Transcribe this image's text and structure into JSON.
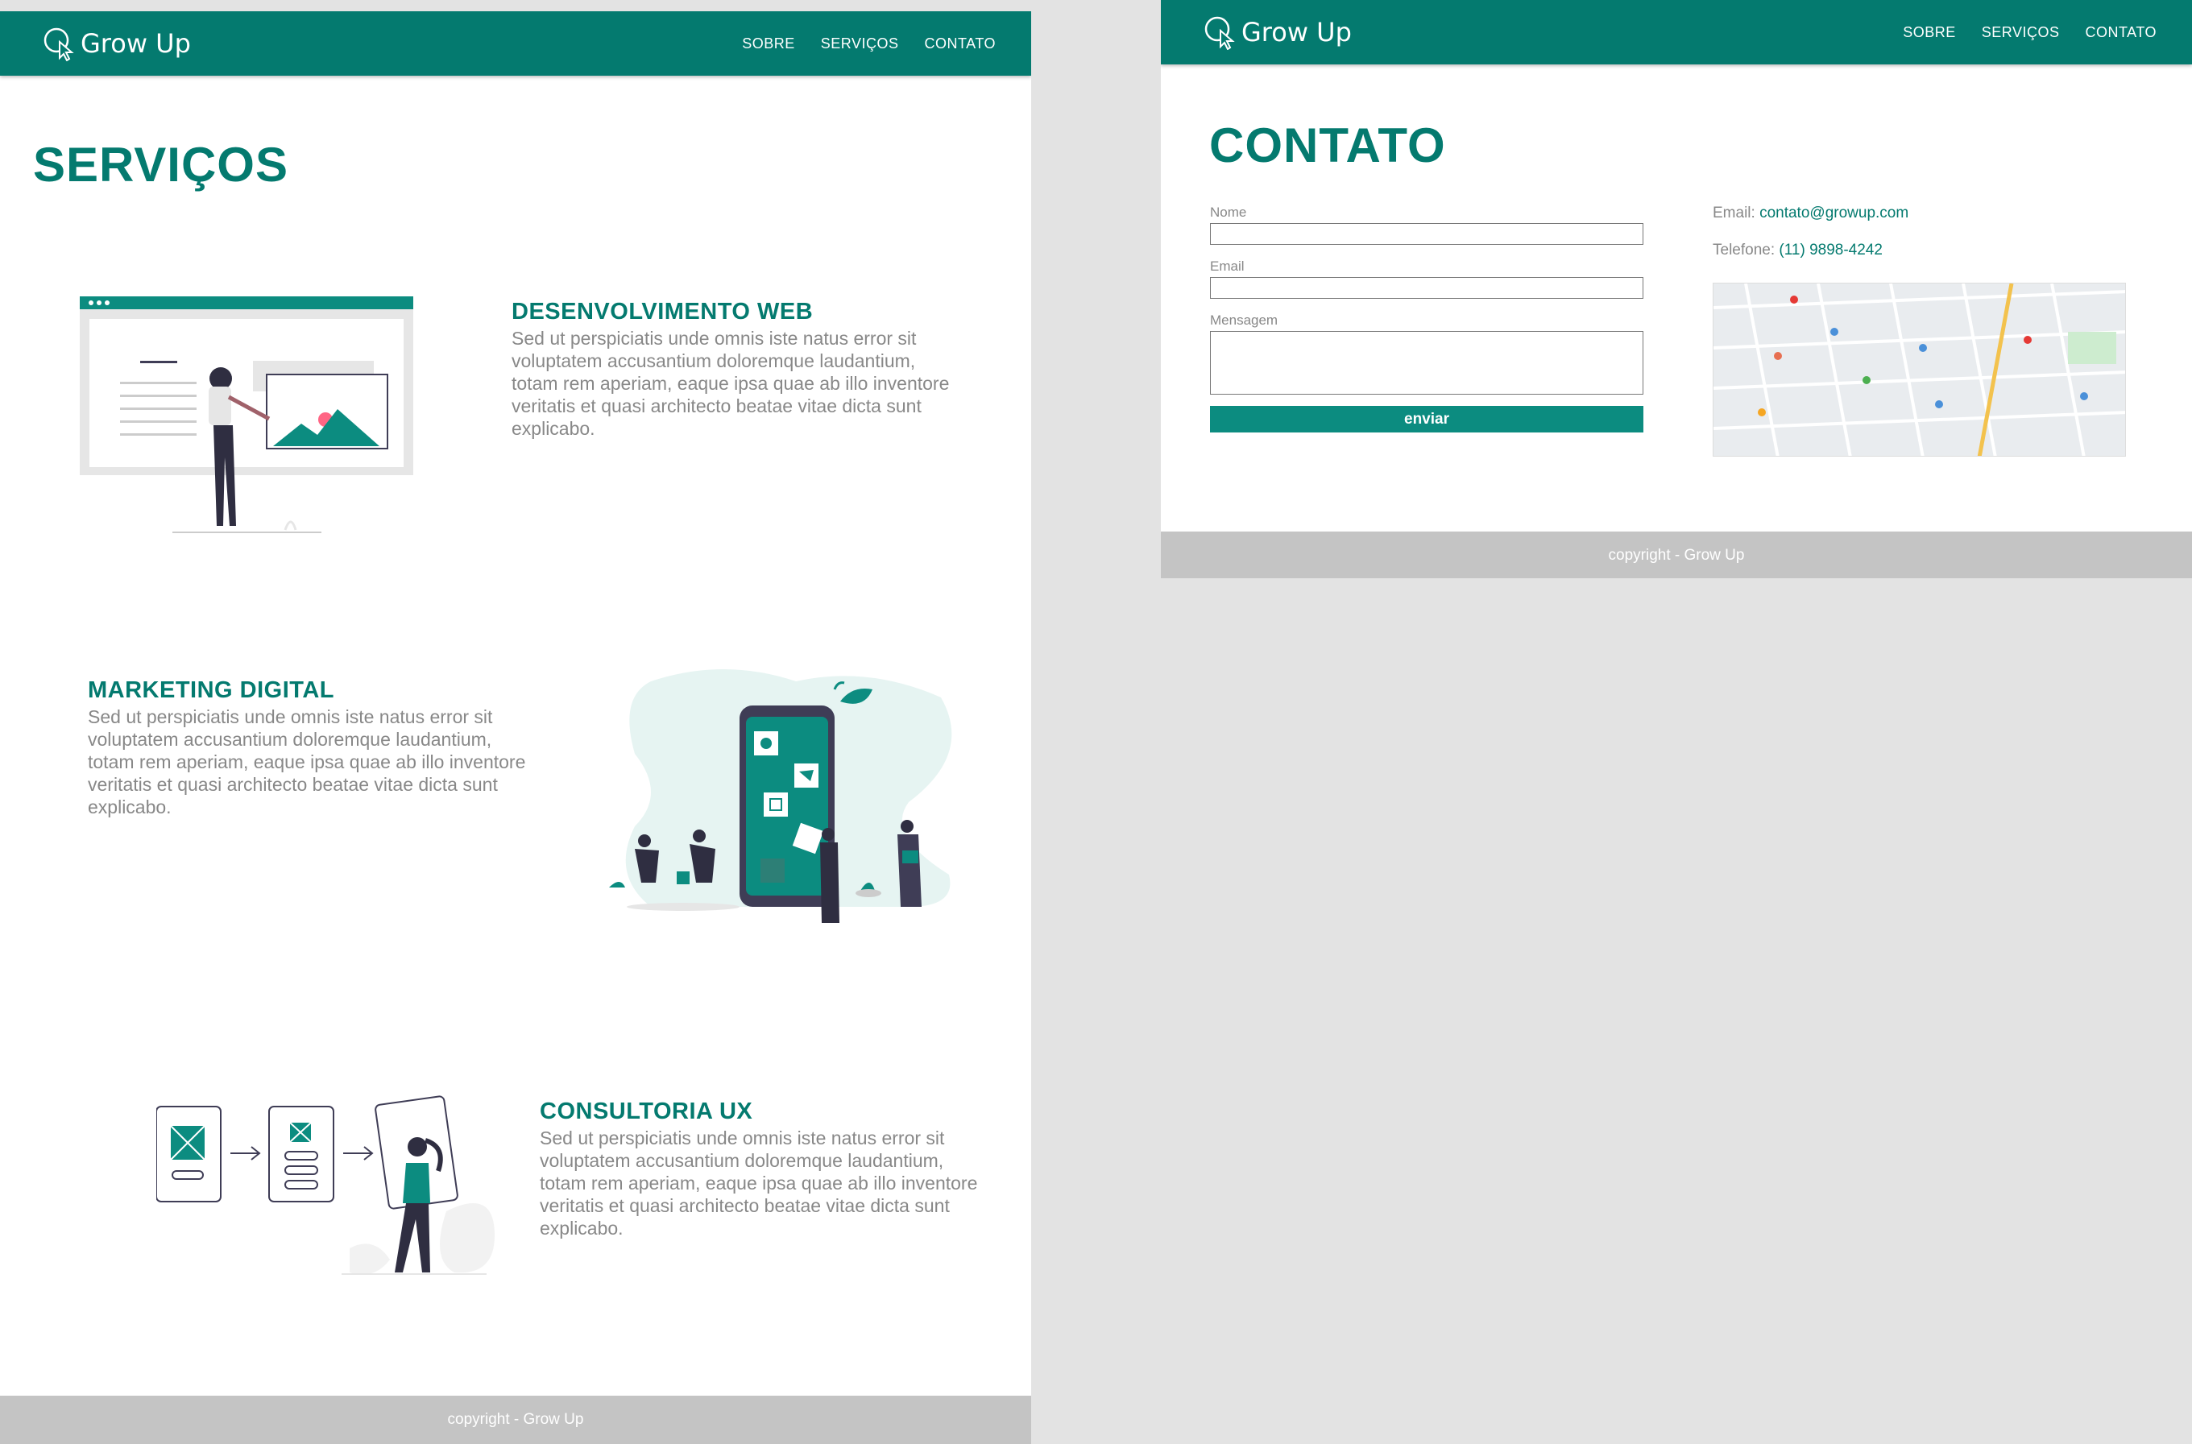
{
  "left_page": {
    "brand": "Grow Up",
    "nav": [
      "SOBRE",
      "SERVIÇOS",
      "CONTATO"
    ],
    "heading": "SERVIÇOS",
    "services": [
      {
        "title": "DESENVOLVIMENTO WEB",
        "text": "Sed ut perspiciatis unde omnis iste natus error sit voluptatem accusantium doloremque laudantium, totam rem aperiam, eaque ipsa quae ab illo inventore veritatis et quasi architecto beatae vitae dicta sunt explicabo."
      },
      {
        "title": "MARKETING DIGITAL",
        "text": "Sed ut perspiciatis unde omnis iste natus error sit voluptatem accusantium doloremque laudantium, totam rem aperiam, eaque ipsa quae ab illo inventore veritatis et quasi architecto beatae vitae dicta sunt explicabo."
      },
      {
        "title": "CONSULTORIA UX",
        "text": "Sed ut perspiciatis unde omnis iste natus error sit voluptatem accusantium doloremque laudantium, totam rem aperiam, eaque ipsa quae ab illo inventore veritatis et quasi architecto beatae vitae dicta sunt explicabo."
      }
    ],
    "footer": "copyright - Grow Up"
  },
  "right_page": {
    "brand": "Grow Up",
    "nav": [
      "SOBRE",
      "SERVIÇOS",
      "CONTATO"
    ],
    "heading": "CONTATO",
    "form": {
      "name_label": "Nome",
      "email_label": "Email",
      "message_label": "Mensagem",
      "submit_label": "enviar"
    },
    "contact": {
      "email_label": "Email:",
      "email_value": "contato@growup.com",
      "phone_label": "Telefone:",
      "phone_value": "(11) 9898-4242"
    },
    "footer": "copyright - Grow Up"
  },
  "colors": {
    "primary": "#047a6f",
    "accent": "#0c8c80",
    "footer": "#c4c4c4",
    "muted_text": "#888888",
    "background": "#e3e3e3"
  },
  "icons": [
    "cursor-logo-icon",
    "map-pin-icon"
  ]
}
